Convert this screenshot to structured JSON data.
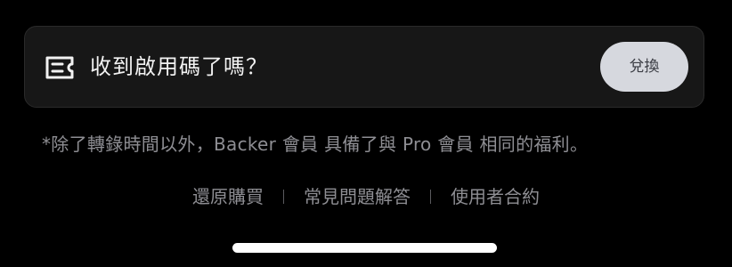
{
  "redeem_card": {
    "icon": "ticket-icon",
    "title": "收到啟用碼了嗎？",
    "button_label": "兌換"
  },
  "footnote": "*除了轉錄時間以外，Backer 會員 具備了與 Pro 會員 相同的福利。",
  "links": {
    "restore": "還原購買",
    "faq": "常見問題解答",
    "terms": "使用者合約"
  },
  "colors": {
    "background": "#000000",
    "card": "#171717",
    "button": "#d6d8de",
    "secondary_text": "#8e8e93"
  }
}
